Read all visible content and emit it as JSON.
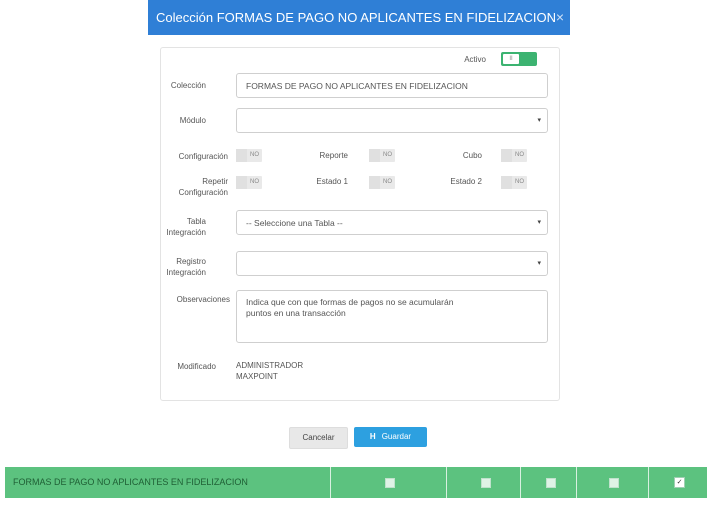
{
  "modal": {
    "title": "Colección FORMAS DE PAGO NO APLICANTES EN FIDELIZACION",
    "close_icon": "×"
  },
  "form": {
    "activo_label": "Activo",
    "activo_toggle": "II",
    "coleccion_label": "Colección",
    "coleccion_value": "FORMAS DE PAGO NO APLICANTES EN FIDELIZACION",
    "modulo_label": "Módulo",
    "modulo_value": "",
    "configuracion_label": "Configuración",
    "reporte_label": "Reporte",
    "cubo_label": "Cubo",
    "repetir_label_1": "Repetir",
    "repetir_label_2": "Configuración",
    "estado1_label": "Estado 1",
    "estado2_label": "Estado 2",
    "toggle_no": "NO",
    "tabla_label_1": "Tabla",
    "tabla_label_2": "Integración",
    "tabla_value": "-- Seleccione una Tabla --",
    "registro_label_1": "Registro",
    "registro_label_2": "Integración",
    "registro_value": "",
    "observaciones_label": "Observaciones",
    "observaciones_line1": "Indica que con que formas de pagos  no se acumularán",
    "observaciones_line2": "puntos en una transacción",
    "modificado_label": "Modificado",
    "modificado_line1": "ADMINISTRADOR",
    "modificado_line2": "MAXPOINT",
    "caret": "▾"
  },
  "buttons": {
    "cancel_label": "Cancelar",
    "save_label": "Guardar",
    "save_icon": "H"
  },
  "table_row": {
    "name": "FORMAS DE PAGO NO APLICANTES EN FIDELIZACION",
    "checked_mark": "✓"
  },
  "colors": {
    "header": "#2f7fd6",
    "accent_green": "#3cb371",
    "row_green": "#5cc27f",
    "save_blue": "#2da0e0"
  }
}
